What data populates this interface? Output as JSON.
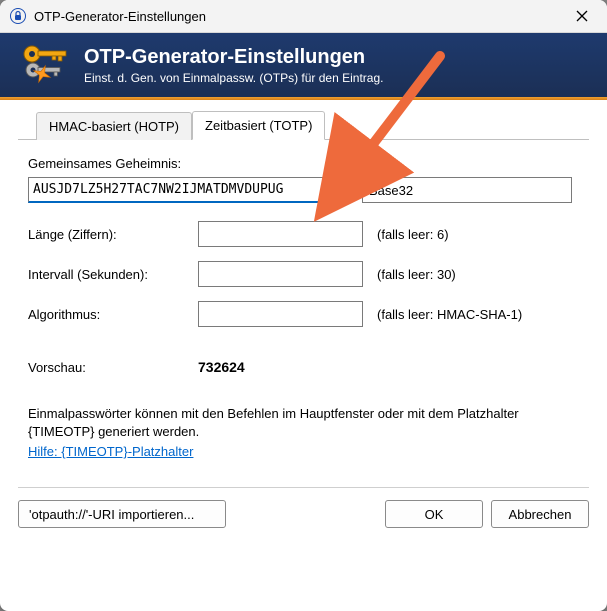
{
  "window": {
    "title": "OTP-Generator-Einstellungen"
  },
  "banner": {
    "title": "OTP-Generator-Einstellungen",
    "subtitle": "Einst. d. Gen. von Einmalpassw. (OTPs) für den Eintrag."
  },
  "tabs": {
    "hotp": "HMAC-basiert (HOTP)",
    "totp": "Zeitbasiert (TOTP)"
  },
  "form": {
    "secret_label": "Gemeinsames Geheimnis:",
    "secret_value": "AUSJD7LZ5H27TAC7NW2IJMATDMVDUPUG",
    "encoding_selected": "Base32",
    "length_label": "Länge (Ziffern):",
    "length_value": "",
    "length_hint": "(falls leer: 6)",
    "interval_label": "Intervall (Sekunden):",
    "interval_value": "",
    "interval_hint": "(falls leer: 30)",
    "algorithm_label": "Algorithmus:",
    "algorithm_value": "",
    "algorithm_hint": "(falls leer: HMAC-SHA-1)",
    "preview_label": "Vorschau:",
    "preview_value": "732624",
    "note": "Einmalpasswörter können mit den Befehlen im Hauptfenster oder mit dem Platzhalter {TIMEOTP} generiert werden.",
    "help_link": "Hilfe: {TIMEOTP}-Platzhalter"
  },
  "footer": {
    "import": "'otpauth://'-URI importieren...",
    "ok": "OK",
    "cancel": "Abbrechen"
  }
}
